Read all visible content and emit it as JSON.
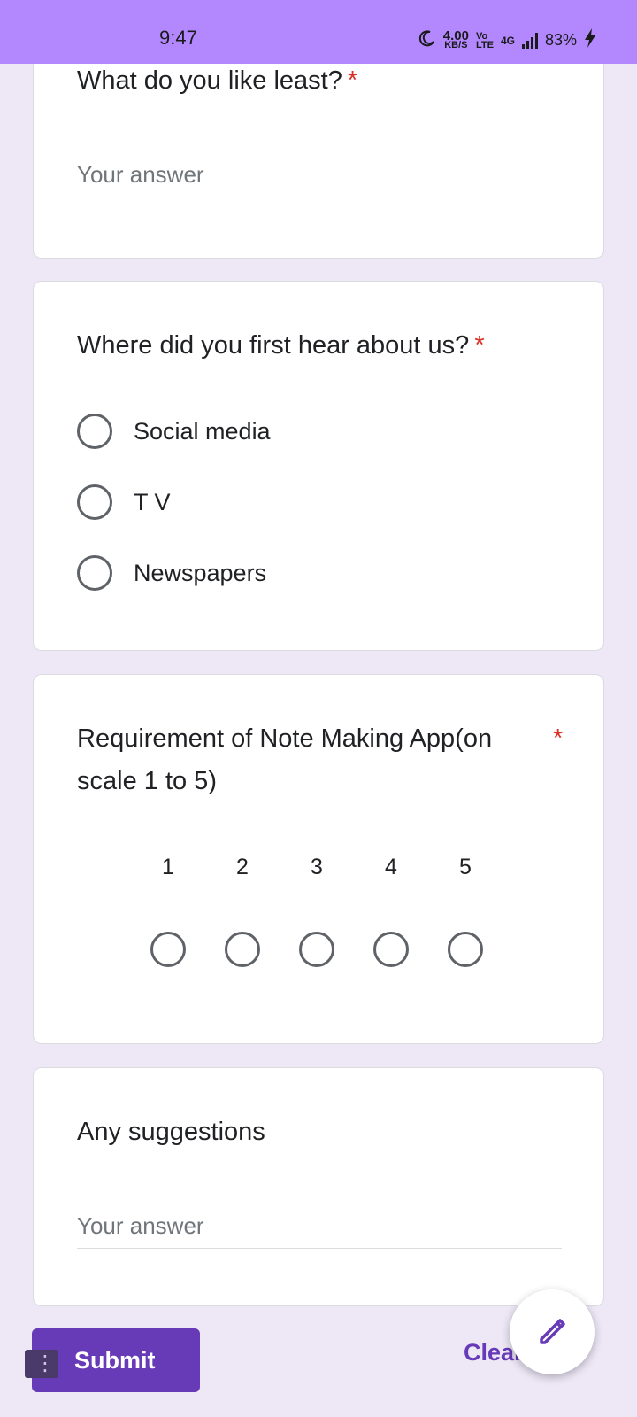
{
  "status_bar": {
    "time": "9:47",
    "speed_value": "4.00",
    "speed_unit": "KB/S",
    "volte_top": "Vo",
    "volte_bottom": "LTE",
    "network": "4G",
    "battery": "83%"
  },
  "questions": {
    "least": {
      "title": "What do you like least?",
      "required_mark": "*",
      "placeholder": "Your answer"
    },
    "hear": {
      "title": "Where did you first hear about us?",
      "required_mark": "*",
      "options": [
        "Social media",
        "T V",
        "Newspapers"
      ]
    },
    "scale": {
      "title_line1": "Requirement of Note Making App(on",
      "title_line2": "scale 1 to 5)",
      "required_mark": "*",
      "numbers": [
        "1",
        "2",
        "3",
        "4",
        "5"
      ]
    },
    "suggestions": {
      "title": "Any suggestions",
      "placeholder": "Your answer"
    }
  },
  "footer": {
    "submit_label": "Submit",
    "clear_label": "Clear form"
  },
  "icons": {
    "moon": "moon-icon",
    "signal": "signal-icon",
    "battery_charging": "bolt-icon",
    "edit": "pencil-icon",
    "drag": "drag-handle-icon"
  },
  "colors": {
    "status_bar": "#b388ff",
    "background": "#ede7f6",
    "accent": "#673ab7",
    "required": "#d93025"
  }
}
